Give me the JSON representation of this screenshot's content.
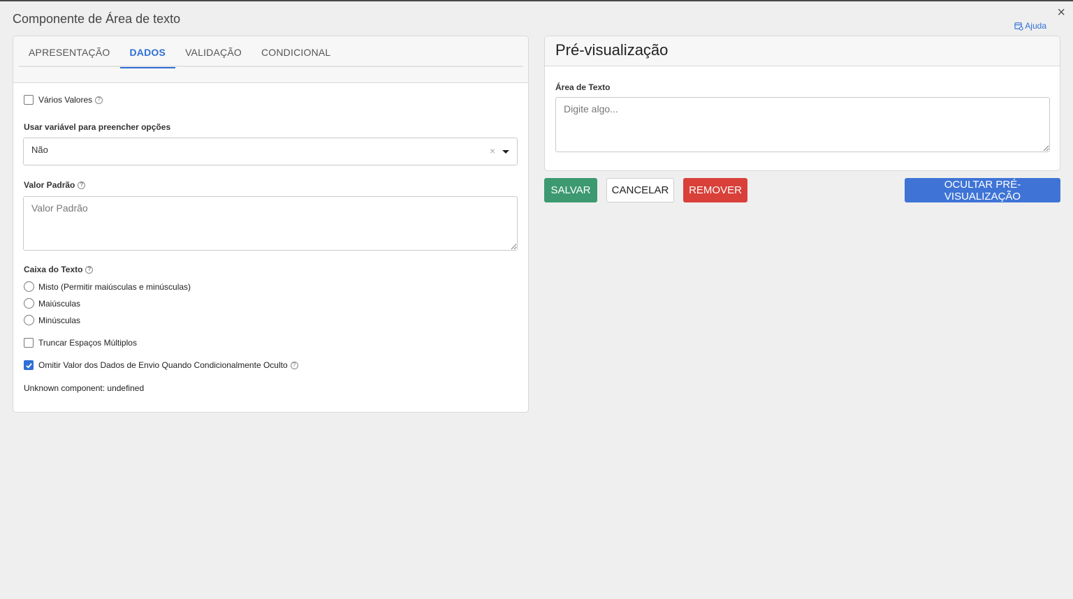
{
  "dialog": {
    "title": "Componente de Área de texto",
    "close_label": "×",
    "help_label": "Ajuda"
  },
  "tabs": [
    {
      "label": "APRESENTAÇÃO",
      "active": false
    },
    {
      "label": "DADOS",
      "active": true
    },
    {
      "label": "VALIDAÇÃO",
      "active": false
    },
    {
      "label": "CONDICIONAL",
      "active": false
    }
  ],
  "form": {
    "multiple_values": {
      "label": "Vários Valores",
      "checked": false
    },
    "variable_options": {
      "label": "Usar variável para preencher opções",
      "value": "Não",
      "clear": "×"
    },
    "default_value": {
      "label": "Valor Padrão",
      "placeholder": "Valor Padrão"
    },
    "text_case": {
      "label": "Caixa do Texto",
      "options": [
        "Misto (Permitir maiúsculas e minúsculas)",
        "Maiúsculas",
        "Minúsculas"
      ]
    },
    "truncate_spaces": {
      "label": "Truncar Espaços Múltiplos",
      "checked": false
    },
    "omit_value": {
      "label": "Omitir Valor dos Dados de Envio Quando Condicionalmente Oculto",
      "checked": true
    },
    "unknown_component": "Unknown component: undefined"
  },
  "preview": {
    "title": "Pré-visualização",
    "field_label": "Área de Texto",
    "placeholder": "Digite algo..."
  },
  "actions": {
    "save": "SALVAR",
    "cancel": "CANCELAR",
    "remove": "REMOVER",
    "hide_preview": "OCULTAR PRÉ-VISUALIZAÇÃO"
  },
  "colors": {
    "accent": "#2f6fd6",
    "save": "#3d9970",
    "remove": "#d9403a",
    "hide_preview": "#3f74d6"
  }
}
